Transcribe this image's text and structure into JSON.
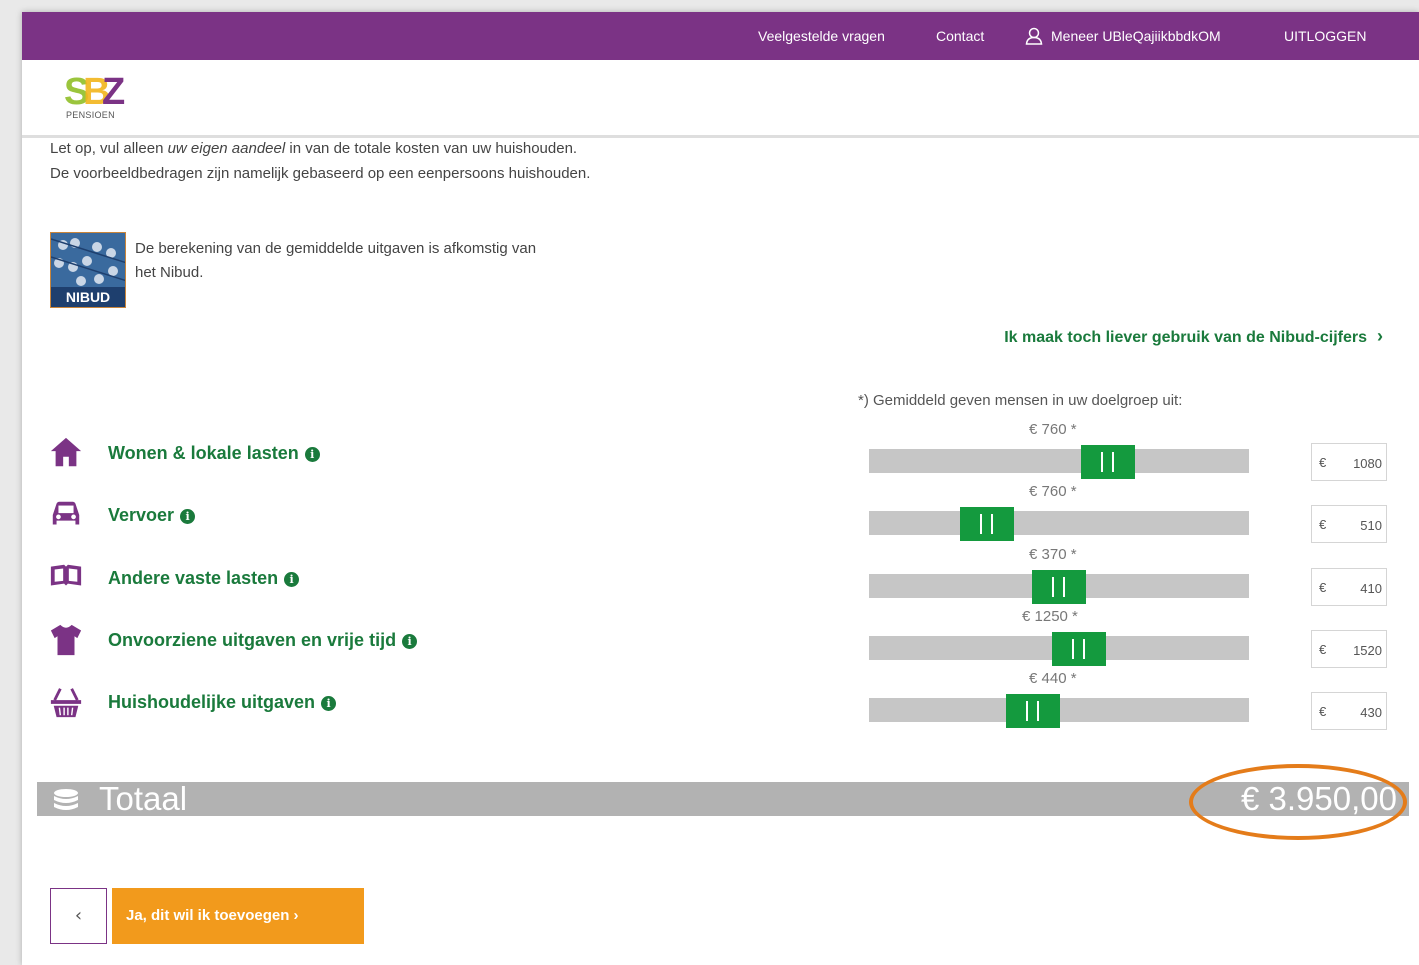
{
  "topbar": {
    "faq": "Veelgestelde vragen",
    "contact": "Contact",
    "user": "Meneer UBleQajiikbbdkOM",
    "logout": "UITLOGGEN"
  },
  "logo": {
    "text": "PENSIOEN",
    "letters": "SBZ"
  },
  "intro": {
    "line1_pre": "Let op, vul alleen ",
    "line1_em": "uw eigen aandeel",
    "line1_post": " in van de totale kosten van uw huishouden.",
    "line2": "De voorbeeldbedragen zijn namelijk gebaseerd op een eenpersoons huishouden."
  },
  "nibud": {
    "badge": "NIBUD",
    "text": "De berekening van de gemiddelde uitgaven is afkomstig van het Nibud."
  },
  "nibud_link": "Ik maak toch liever gebruik van de Nibud-cijfers",
  "avg_note": "*) Gemiddeld geven mensen in uw doelgroep uit:",
  "categories": [
    {
      "label": "Wonen & lokale lasten",
      "icon": "house-icon",
      "avg": "€ 760 *",
      "currency": "€",
      "value": "1080",
      "slider_fraction": 0.65
    },
    {
      "label": "Vervoer",
      "icon": "car-icon",
      "avg": "€ 760 *",
      "currency": "€",
      "value": "510",
      "slider_fraction": 0.28
    },
    {
      "label": "Andere vaste lasten",
      "icon": "book-icon",
      "avg": "€ 370 *",
      "currency": "€",
      "value": "410",
      "slider_fraction": 0.5
    },
    {
      "label": "Onvoorziene uitgaven en vrije tijd",
      "icon": "shirt-icon",
      "avg": "€ 1250 *",
      "currency": "€",
      "value": "1520",
      "slider_fraction": 0.56
    },
    {
      "label": "Huishoudelijke uitgaven",
      "icon": "basket-icon",
      "avg": "€ 440 *",
      "currency": "€",
      "value": "430",
      "slider_fraction": 0.42
    }
  ],
  "total": {
    "label": "Totaal",
    "value": "€ 3.950,00"
  },
  "buttons": {
    "back": "‹",
    "add": "Ja, dit wil ik toevoegen ›"
  },
  "colors": {
    "purple": "#7b3385",
    "green": "#1a7a3c",
    "slider": "#149a3e",
    "orange": "#f29a1c",
    "highlight": "#e47c1a"
  }
}
